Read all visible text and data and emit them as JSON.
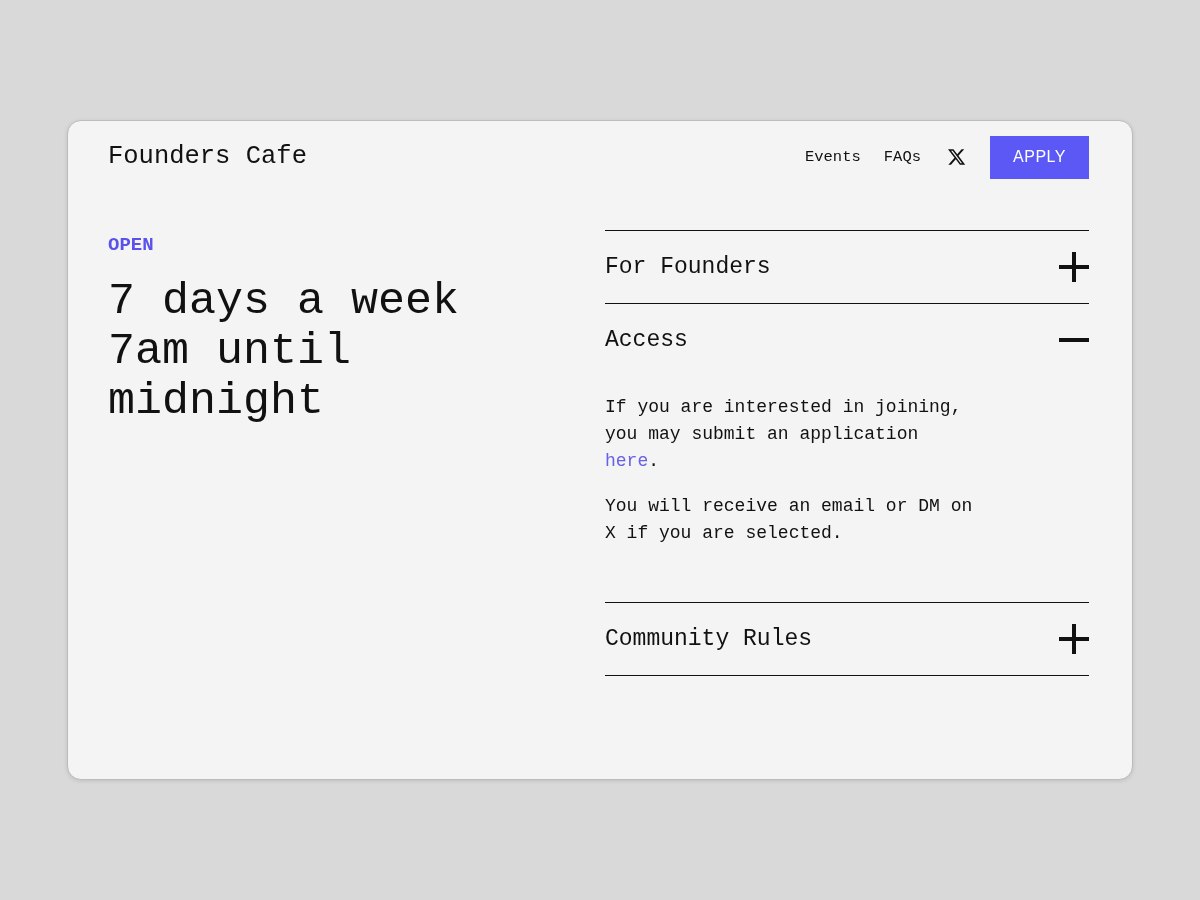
{
  "header": {
    "brand": "Founders Cafe",
    "nav": [
      {
        "label": "Events"
      },
      {
        "label": "FAQs"
      }
    ],
    "button": "APPLY"
  },
  "hero": {
    "label": "OPEN",
    "heading_lines": [
      "7 days a week",
      "7am until midnight"
    ]
  },
  "accordion": {
    "items": [
      {
        "title": "For Founders",
        "expanded": false
      },
      {
        "title": "Access",
        "expanded": true,
        "paragraphs": [
          {
            "parts": [
              {
                "kind": "text",
                "text": "If you are interested in joining, you may submit an application "
              },
              {
                "kind": "link",
                "text": "here"
              },
              {
                "kind": "text",
                "text": "."
              }
            ]
          },
          {
            "parts": [
              {
                "kind": "text",
                "text": "You will receive an email or DM on X if you are selected."
              }
            ]
          }
        ]
      },
      {
        "title": "Community Rules",
        "expanded": false
      }
    ]
  }
}
